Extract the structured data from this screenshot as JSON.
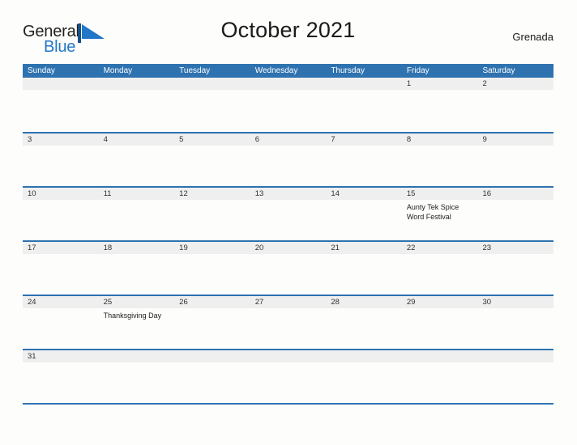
{
  "logo": {
    "word_top": "General",
    "word_bottom": "Blue",
    "mark_icon": "blue-flag-triangle-icon"
  },
  "header": {
    "title": "October 2021",
    "location": "Grenada"
  },
  "colors": {
    "header_blue": "#2e72b0",
    "logo_blue": "#2176c7",
    "date_band": "#efefef",
    "page_background": "#fdfdfb"
  },
  "calendar": {
    "weekdays": [
      "Sunday",
      "Monday",
      "Tuesday",
      "Wednesday",
      "Thursday",
      "Friday",
      "Saturday"
    ],
    "weeks": [
      [
        {
          "date": "",
          "events": []
        },
        {
          "date": "",
          "events": []
        },
        {
          "date": "",
          "events": []
        },
        {
          "date": "",
          "events": []
        },
        {
          "date": "",
          "events": []
        },
        {
          "date": "1",
          "events": []
        },
        {
          "date": "2",
          "events": []
        }
      ],
      [
        {
          "date": "3",
          "events": []
        },
        {
          "date": "4",
          "events": []
        },
        {
          "date": "5",
          "events": []
        },
        {
          "date": "6",
          "events": []
        },
        {
          "date": "7",
          "events": []
        },
        {
          "date": "8",
          "events": []
        },
        {
          "date": "9",
          "events": []
        }
      ],
      [
        {
          "date": "10",
          "events": []
        },
        {
          "date": "11",
          "events": []
        },
        {
          "date": "12",
          "events": []
        },
        {
          "date": "13",
          "events": []
        },
        {
          "date": "14",
          "events": []
        },
        {
          "date": "15",
          "events": [
            "Aunty Tek Spice",
            "Word Festival"
          ]
        },
        {
          "date": "16",
          "events": []
        }
      ],
      [
        {
          "date": "17",
          "events": []
        },
        {
          "date": "18",
          "events": []
        },
        {
          "date": "19",
          "events": []
        },
        {
          "date": "20",
          "events": []
        },
        {
          "date": "21",
          "events": []
        },
        {
          "date": "22",
          "events": []
        },
        {
          "date": "23",
          "events": []
        }
      ],
      [
        {
          "date": "24",
          "events": []
        },
        {
          "date": "25",
          "events": [
            "Thanksgiving Day"
          ]
        },
        {
          "date": "26",
          "events": []
        },
        {
          "date": "27",
          "events": []
        },
        {
          "date": "28",
          "events": []
        },
        {
          "date": "29",
          "events": []
        },
        {
          "date": "30",
          "events": []
        }
      ],
      [
        {
          "date": "31",
          "events": []
        },
        {
          "date": "",
          "events": []
        },
        {
          "date": "",
          "events": []
        },
        {
          "date": "",
          "events": []
        },
        {
          "date": "",
          "events": []
        },
        {
          "date": "",
          "events": []
        },
        {
          "date": "",
          "events": []
        }
      ]
    ]
  }
}
